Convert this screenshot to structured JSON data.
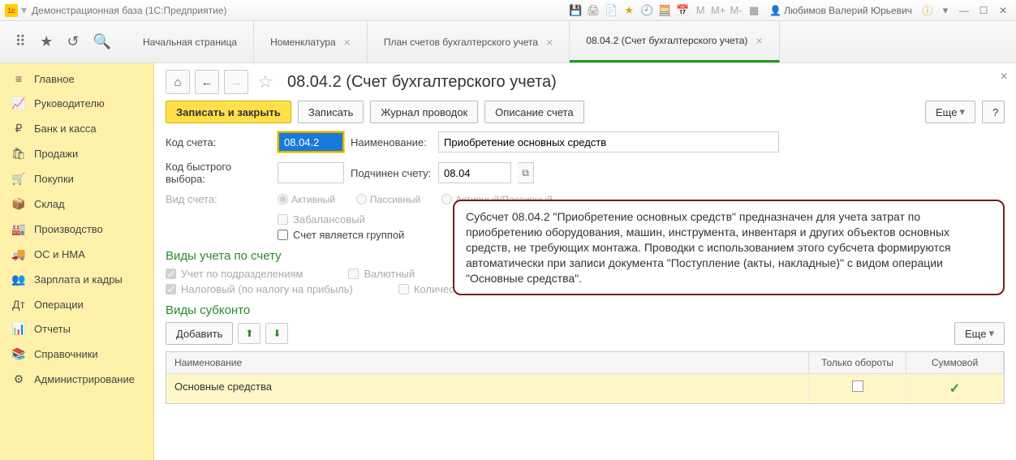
{
  "window": {
    "title": "Демонстрационная база  (1С:Предприятие)",
    "user": "Любимов Валерий Юрьевич"
  },
  "tabs": {
    "t0": "Начальная страница",
    "t1": "Номенклатура",
    "t2": "План счетов бухгалтерского учета",
    "t3": "08.04.2 (Счет бухгалтерского учета)"
  },
  "sidebar": {
    "items": [
      {
        "icon": "≡",
        "label": "Главное"
      },
      {
        "icon": "📈",
        "label": "Руководителю"
      },
      {
        "icon": "₽",
        "label": "Банк и касса"
      },
      {
        "icon": "🛍",
        "label": "Продажи"
      },
      {
        "icon": "🛒",
        "label": "Покупки"
      },
      {
        "icon": "📦",
        "label": "Склад"
      },
      {
        "icon": "🏭",
        "label": "Производство"
      },
      {
        "icon": "🚚",
        "label": "ОС и НМА"
      },
      {
        "icon": "👥",
        "label": "Зарплата и кадры"
      },
      {
        "icon": "ᴬᴮ",
        "label": "Операции"
      },
      {
        "icon": "📊",
        "label": "Отчеты"
      },
      {
        "icon": "📚",
        "label": "Справочники"
      },
      {
        "icon": "⚙",
        "label": "Администрирование"
      }
    ]
  },
  "page": {
    "title": "08.04.2 (Счет бухгалтерского учета)",
    "buttons": {
      "save_close": "Записать и закрыть",
      "save": "Записать",
      "journal": "Журнал проводок",
      "desc": "Описание счета",
      "more": "Еще",
      "add": "Добавить"
    },
    "labels": {
      "code": "Код счета:",
      "name": "Наименование:",
      "quick": "Код быстрого выбора:",
      "parent": "Подчинен счету:",
      "kind": "Вид счета:",
      "offbalance": "Забалансовый",
      "isgroup": "Счет является группой",
      "accounting_sect": "Виды учета по счету",
      "by_dept": "Учет по подразделениям",
      "currency": "Валютный",
      "tax": "Налоговый (по налогу на прибыль)",
      "qty": "Количественный",
      "subconto_sect": "Виды субконто"
    },
    "values": {
      "code": "08.04.2",
      "name": "Приобретение основных средств",
      "quick": "",
      "parent": "08.04"
    },
    "radios": {
      "active": "Активный",
      "passive": "Пассивный",
      "both": "Активный/Пассивный"
    },
    "callout": "Субсчет 08.04.2 \"Приобретение основных средств\" предназначен для учета затрат по приобретению оборудования, машин, инструмента, инвентаря и других объектов основных средств, не требующих монтажа. Проводки с использованием этого субсчета формируются автоматически при записи документа \"Поступление (акты, накладные)\" с видом операции \"Основные средства\".",
    "table": {
      "headers": {
        "name": "Наименование",
        "turn": "Только обороты",
        "sum": "Суммовой"
      },
      "row": {
        "name": "Основные средства"
      }
    }
  }
}
